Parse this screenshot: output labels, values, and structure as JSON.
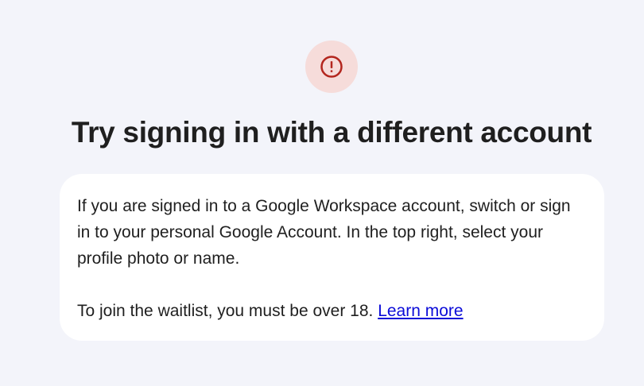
{
  "alert": {
    "icon": "error-circle-icon",
    "icon_color": "#b3261e",
    "badge_color": "#f6dcda"
  },
  "heading": "Try signing in with a different account",
  "card": {
    "body": "If you are signed in to a Google Workspace account, switch or sign in to your personal Google Account. In the top right, select your profile photo or name.",
    "waitlist_text": "To join the waitlist, you must be over 18. ",
    "learn_more_label": "Learn more"
  }
}
